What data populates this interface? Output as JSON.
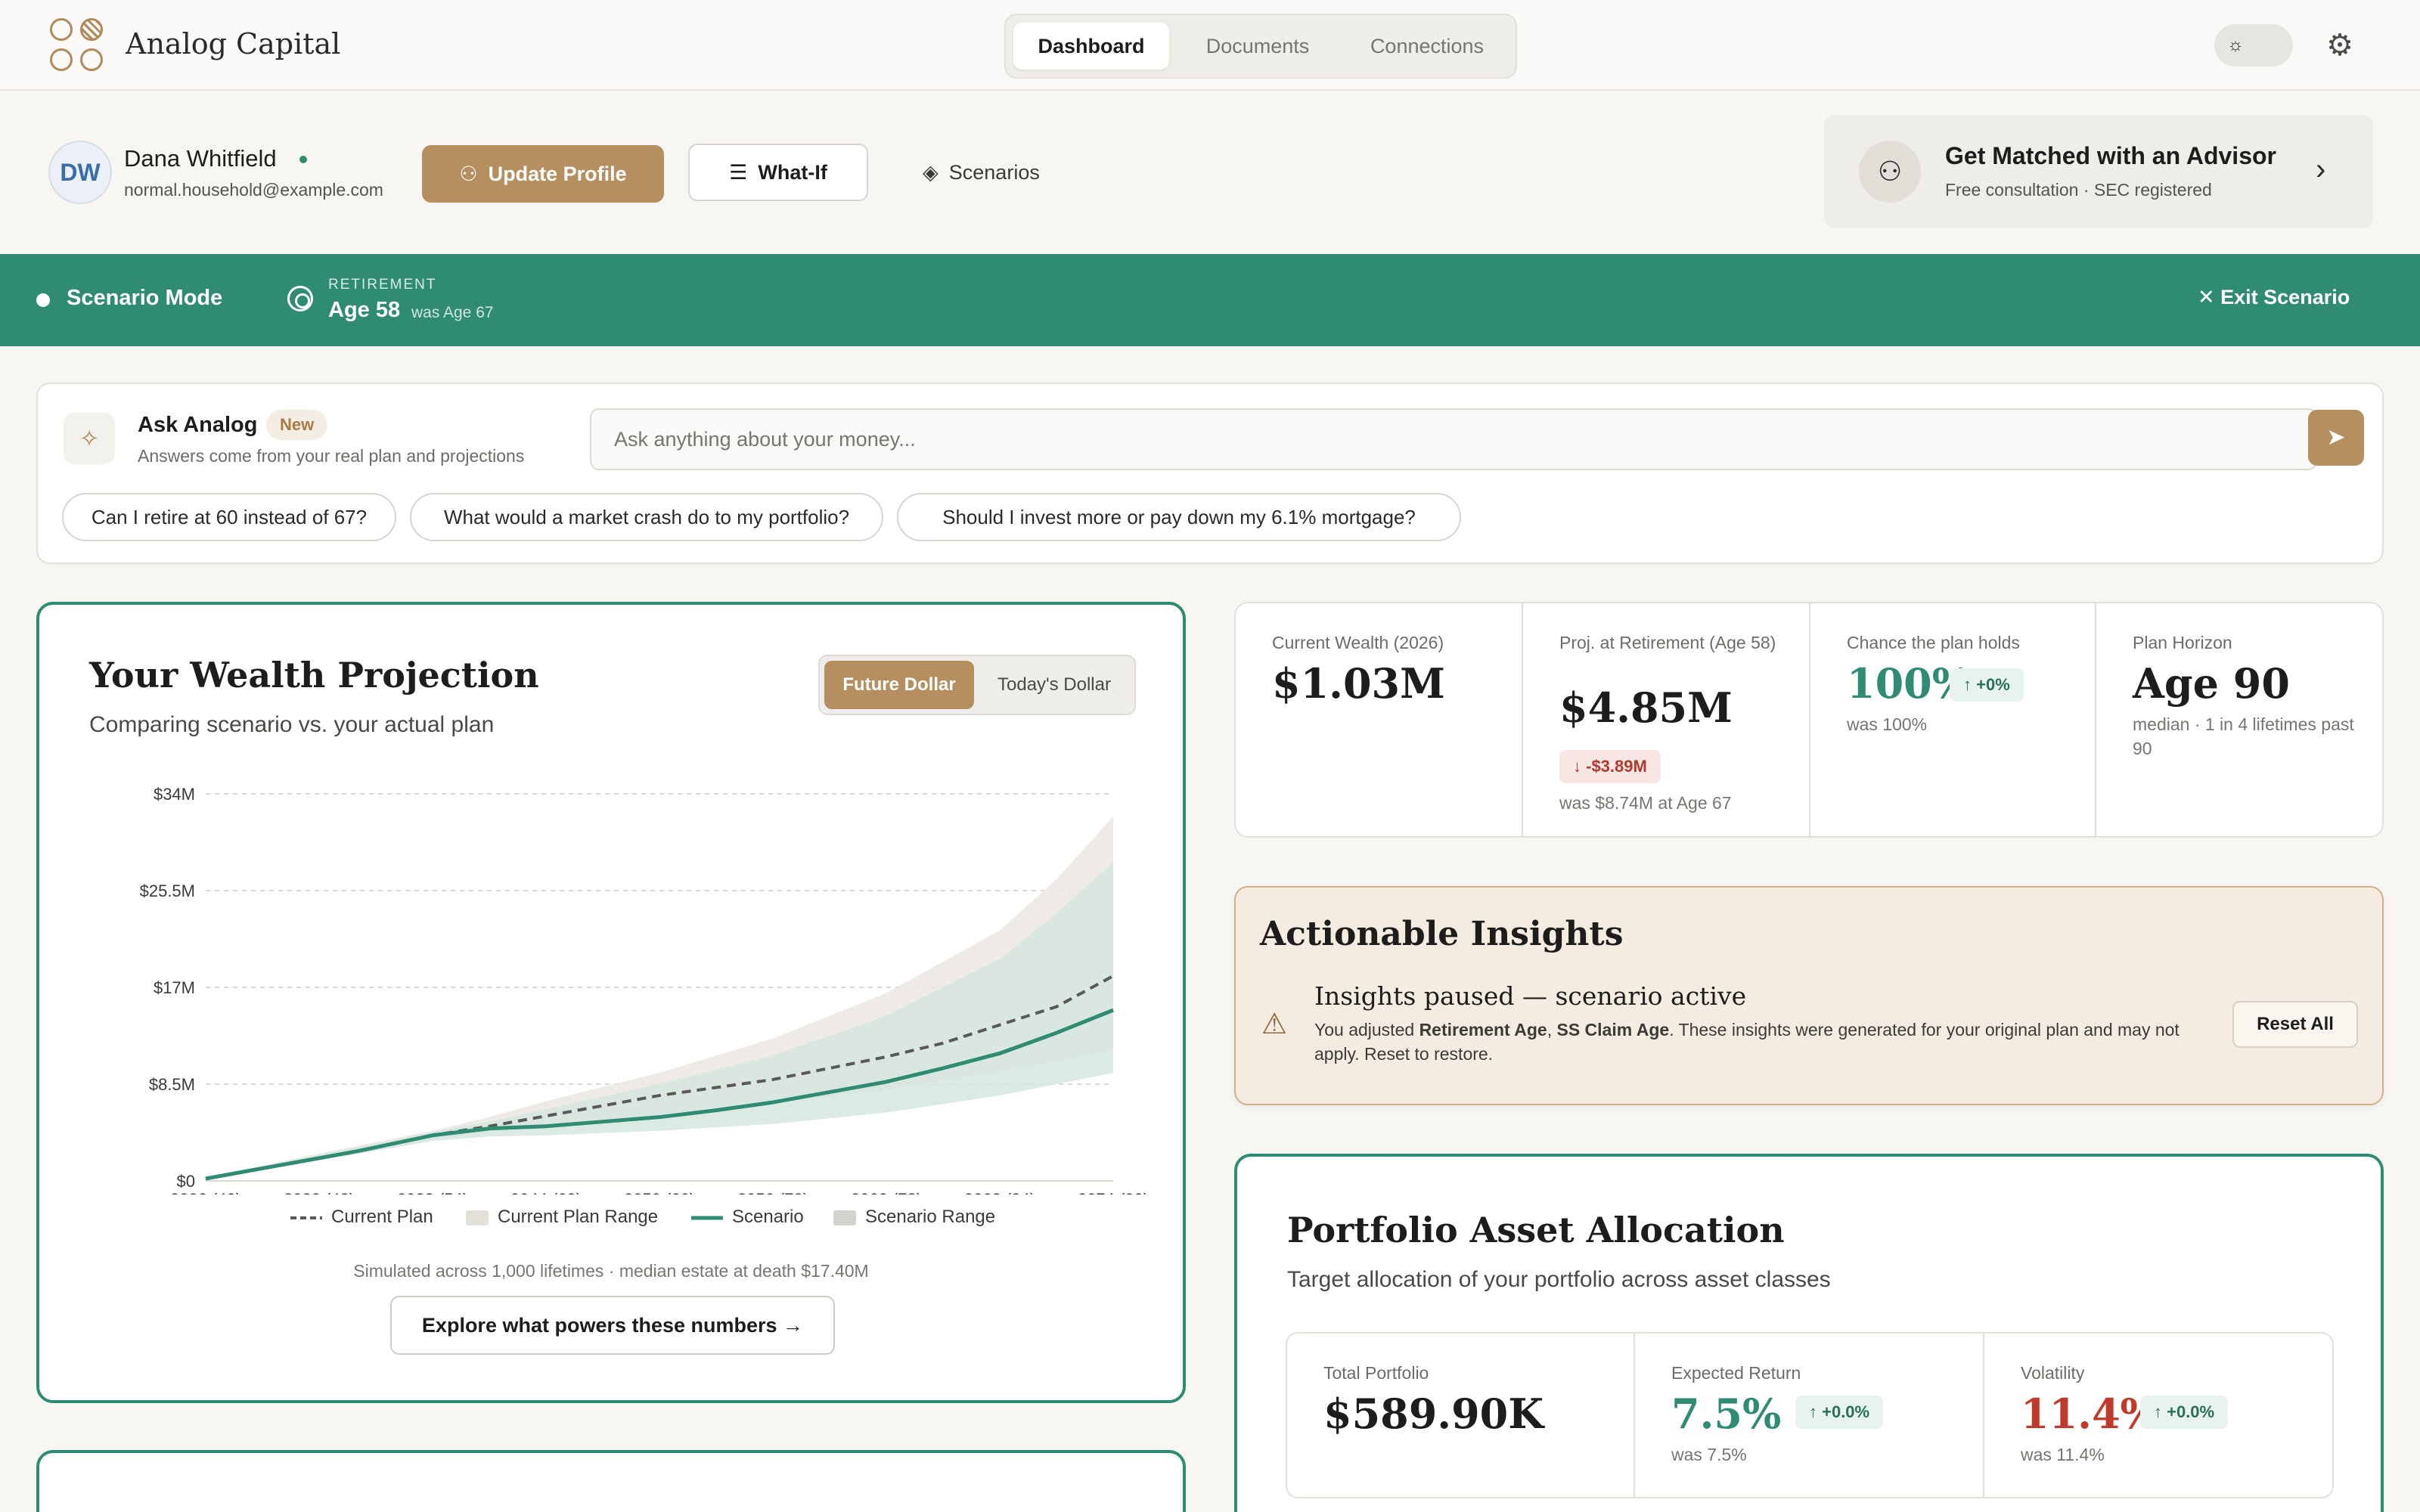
{
  "app": {
    "brand": "Analog Capital",
    "tabs": [
      {
        "label": "Dashboard",
        "active": true
      },
      {
        "label": "Documents",
        "active": false
      },
      {
        "label": "Connections",
        "active": false
      }
    ]
  },
  "profile": {
    "initials": "DW",
    "name": "Dana Whitfield",
    "email": "normal.household@example.com",
    "update_label": "Update Profile",
    "whatif_label": "What-If",
    "scenarios_label": "Scenarios"
  },
  "advisor": {
    "title": "Get Matched with an Advisor",
    "subtitle": "Free consultation · SEC registered"
  },
  "scenario": {
    "mode_label": "Scenario Mode",
    "field_label": "RETIREMENT",
    "value": "Age 58",
    "was": "was Age 67",
    "exit_label": "Exit Scenario"
  },
  "ask": {
    "title": "Ask Analog",
    "badge": "New",
    "subtitle": "Answers come from your real plan and projections",
    "placeholder": "Ask anything about your money...",
    "chips": [
      "Can I retire at 60 instead of 67?",
      "What would a market crash do to my portfolio?",
      "Should I invest more or pay down my 6.1% mortgage?"
    ]
  },
  "projection": {
    "title": "Your Wealth Projection",
    "subtitle": "Comparing scenario vs. your actual plan",
    "toggle": {
      "future": "Future Dollar",
      "today": "Today's Dollar"
    },
    "footnote": "Simulated across 1,000 lifetimes · median estate at death $17.40M",
    "explore_label": "Explore what powers these numbers →"
  },
  "chart_data": {
    "type": "line",
    "ylim": [
      0,
      34
    ],
    "y_ticks": [
      "$0",
      "$8.5M",
      "$17M",
      "$25.5M",
      "$34M"
    ],
    "y_tick_values": [
      0,
      8.5,
      17,
      25.5,
      34
    ],
    "x_range": [
      2026,
      2074
    ],
    "x_ticks": [
      "2026 (42)",
      "2032 (48)",
      "2038 (54)",
      "2044 (60)",
      "2050 (66)",
      "2056 (72)",
      "2062 (78)",
      "2068 (84)",
      "2074 (90)"
    ],
    "x_tick_values": [
      2026,
      2032,
      2038,
      2044,
      2050,
      2056,
      2062,
      2068,
      2074
    ],
    "legend": [
      "Current Plan",
      "Current Plan Range",
      "Scenario",
      "Scenario Range"
    ],
    "series": [
      {
        "name": "Current Plan",
        "style": "dashed",
        "color": "#5a5955",
        "x": [
          2026,
          2030,
          2034,
          2038,
          2041,
          2044,
          2047,
          2050,
          2053,
          2056,
          2059,
          2062,
          2065,
          2068,
          2071,
          2074
        ],
        "y": [
          0.2,
          1.4,
          2.6,
          4.0,
          4.8,
          5.7,
          6.6,
          7.5,
          8.2,
          8.9,
          9.9,
          10.9,
          12.1,
          13.7,
          15.3,
          18.0
        ]
      },
      {
        "name": "Scenario",
        "style": "solid",
        "color": "#2f8b72",
        "x": [
          2026,
          2030,
          2034,
          2038,
          2041,
          2044,
          2047,
          2050,
          2053,
          2056,
          2059,
          2062,
          2065,
          2068,
          2071,
          2074
        ],
        "y": [
          0.2,
          1.4,
          2.6,
          4.0,
          4.6,
          4.8,
          5.2,
          5.6,
          6.2,
          6.9,
          7.8,
          8.7,
          9.9,
          11.2,
          13.0,
          15.0
        ]
      }
    ],
    "ranges": [
      {
        "name": "Current Plan Range",
        "color": "#ebe8e2",
        "x": [
          2026,
          2032,
          2038,
          2041,
          2044,
          2050,
          2056,
          2062,
          2068,
          2071,
          2074
        ],
        "low": [
          0.1,
          1.8,
          3.6,
          4.3,
          4.9,
          5.8,
          6.8,
          8.0,
          9.6,
          10.5,
          11.5
        ],
        "high": [
          0.3,
          2.4,
          4.4,
          5.6,
          7.0,
          9.5,
          12.5,
          16.5,
          22.0,
          26.5,
          32.0
        ]
      },
      {
        "name": "Scenario Range",
        "color": "#d5e6de",
        "x": [
          2026,
          2032,
          2038,
          2041,
          2044,
          2050,
          2056,
          2062,
          2068,
          2071,
          2074
        ],
        "low": [
          0.1,
          1.8,
          3.5,
          3.9,
          4.0,
          4.4,
          5.0,
          6.0,
          7.5,
          8.5,
          9.5
        ],
        "high": [
          0.3,
          2.3,
          4.3,
          5.2,
          6.3,
          8.5,
          11.0,
          14.5,
          19.5,
          23.5,
          28.0
        ]
      }
    ]
  },
  "stats": [
    {
      "label": "Current Wealth (2026)",
      "value": "$1.03M"
    },
    {
      "label": "Proj. at Retirement (Age 58)",
      "value": "$4.85M",
      "badge": "↓ -$3.89M",
      "note": "was $8.74M at Age 67"
    },
    {
      "label": "Chance the plan holds",
      "value": "100%",
      "badge": "↑ +0%",
      "note": "was 100%"
    },
    {
      "label": "Plan Horizon",
      "value": "Age 90",
      "note": "median · 1 in 4 lifetimes past 90"
    }
  ],
  "insights": {
    "title": "Actionable Insights",
    "heading": "Insights paused — scenario active",
    "body_prefix": "You adjusted ",
    "body_b1": "Retirement Age",
    "body_sep": ", ",
    "body_b2": "SS Claim Age",
    "body_suffix": ". These insights were generated for your original plan and may not apply. Reset to restore.",
    "reset_label": "Reset All"
  },
  "allocation": {
    "title": "Portfolio Asset Allocation",
    "subtitle": "Target allocation of your portfolio across asset classes",
    "stats": [
      {
        "label": "Total Portfolio",
        "value": "$589.90K"
      },
      {
        "label": "Expected Return",
        "value": "7.5%",
        "badge": "↑ +0.0%",
        "note": "was 7.5%"
      },
      {
        "label": "Volatility",
        "value": "11.4%",
        "badge": "↑ +0.0%",
        "note": "was 11.4%"
      }
    ]
  }
}
